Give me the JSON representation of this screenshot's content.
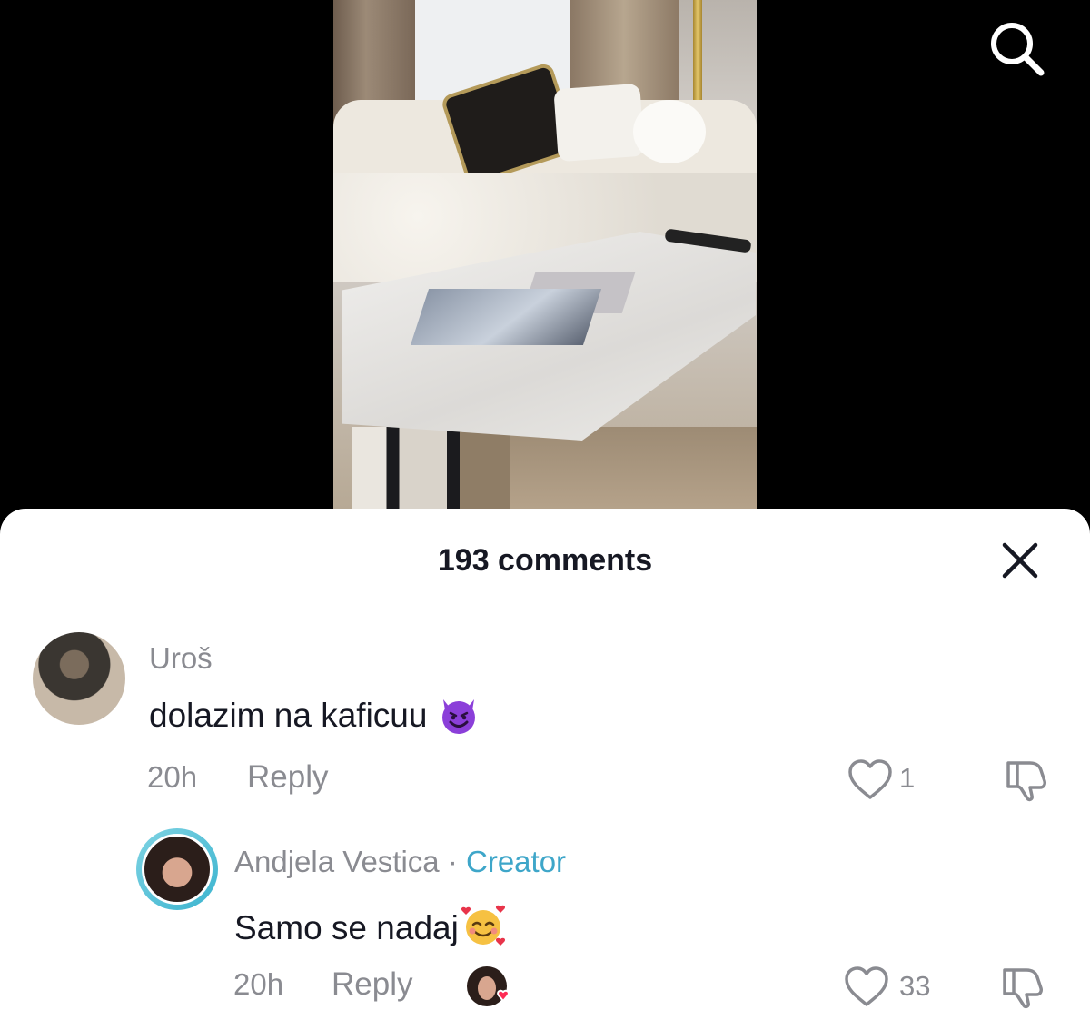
{
  "header": {
    "search_icon": "search-icon"
  },
  "comments_sheet": {
    "title": "193 comments",
    "close_icon": "close-icon"
  },
  "comments": [
    {
      "username": "Uroš",
      "text": "dolazim na kaficuu",
      "emoji": "smiling-devil-emoji",
      "time": "20h",
      "reply_label": "Reply",
      "like_count": "1"
    }
  ],
  "replies": [
    {
      "username": "Andjela Vestica",
      "separator": "·",
      "badge": "Creator",
      "text": "Samo se nadaj",
      "emoji": "smiling-face-with-hearts-emoji",
      "time": "20h",
      "reply_label": "Reply",
      "like_count": "33",
      "liked_by_creator": true
    }
  ],
  "colors": {
    "creator_badge": "#3ea6c9",
    "muted_text": "#8a8b91",
    "primary_text": "#161823"
  }
}
